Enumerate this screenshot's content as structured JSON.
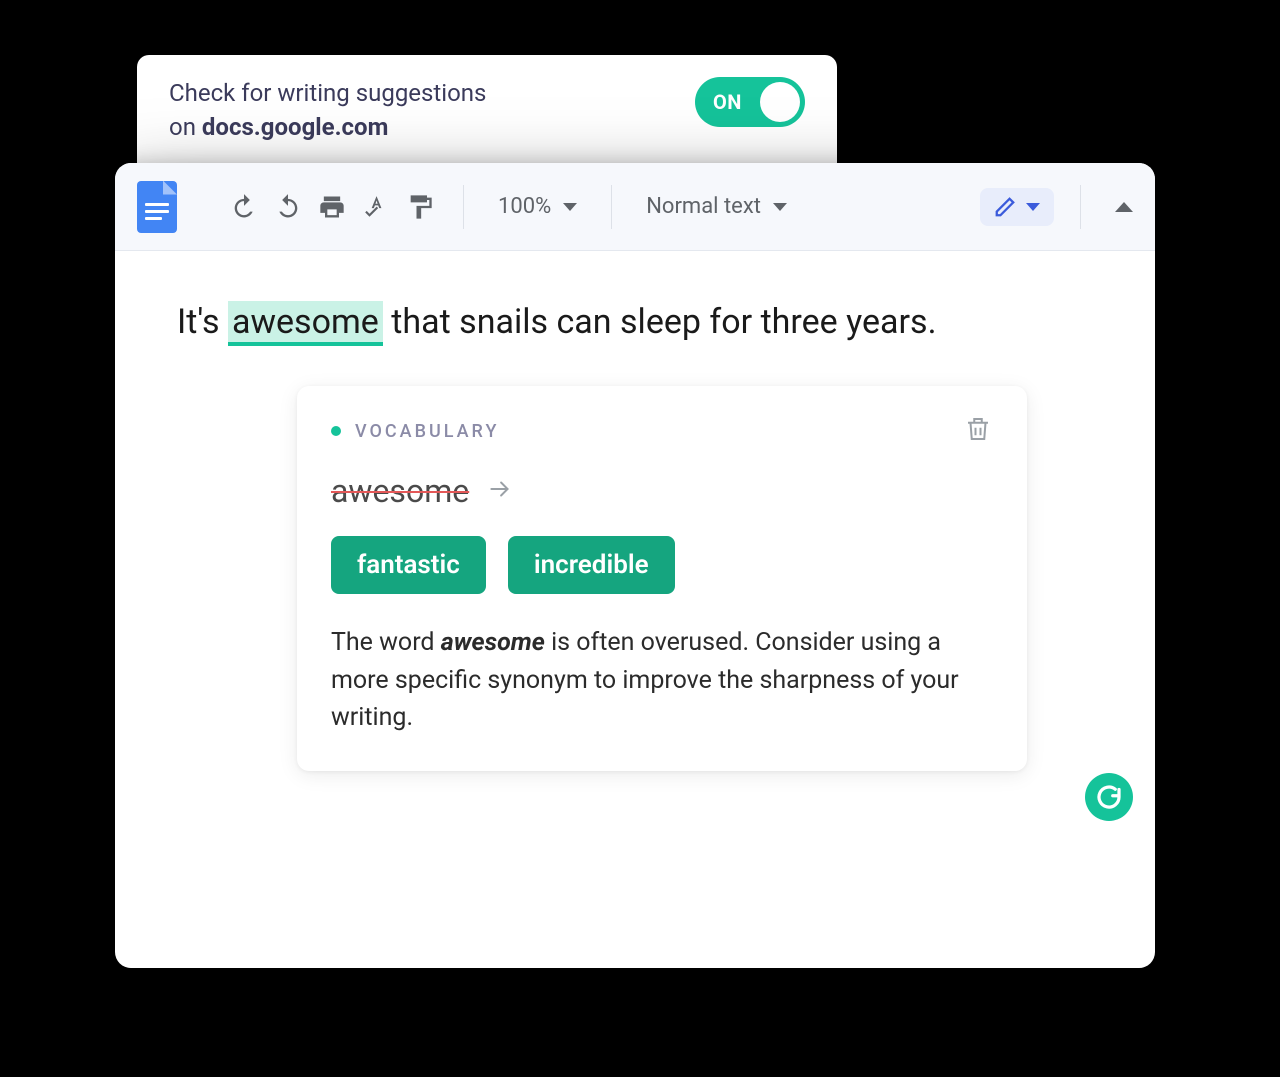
{
  "settings": {
    "line1": "Check for writing suggestions",
    "line2_prefix": "on ",
    "domain": "docs.google.com",
    "toggle_label": "ON"
  },
  "toolbar": {
    "zoom": "100%",
    "style": "Normal text"
  },
  "document": {
    "prefix": "It's ",
    "highlighted": "awesome",
    "suffix": " that snails can sleep for three years."
  },
  "suggestion": {
    "category": "VOCABULARY",
    "original": "awesome",
    "replacements": [
      "fantastic",
      "incredible"
    ],
    "desc_prefix": "The word ",
    "desc_bold": "awesome",
    "desc_suffix": " is often overused. Consider using a more specific synonym to improve the sharpness of your writing."
  }
}
